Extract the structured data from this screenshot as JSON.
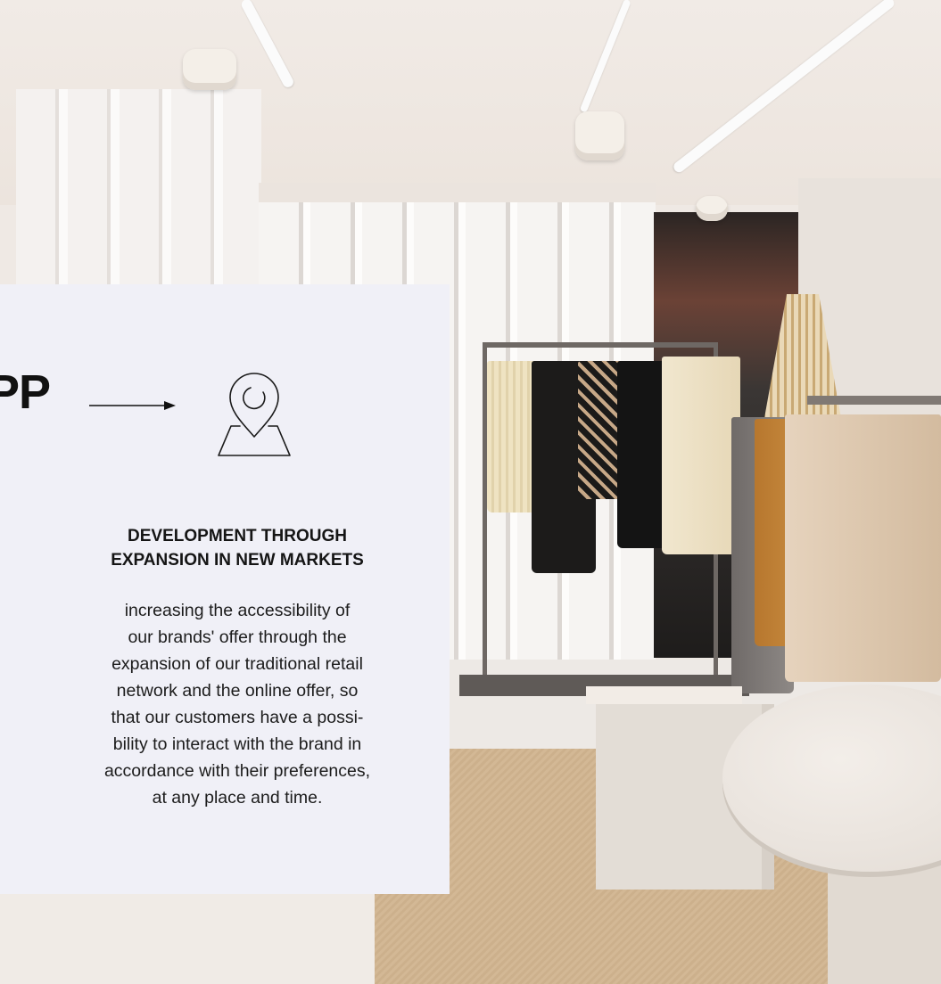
{
  "scene": {
    "description_icon": "store-interior-photo"
  },
  "card": {
    "brand_fragment": "PP",
    "arrow_icon": "right-arrow-icon",
    "location_icon": "map-pin-icon",
    "title_line1": "DEVELOPMENT THROUGH",
    "title_line2": "EXPANSION IN NEW MARKETS",
    "body_lines": [
      "increasing the accessibility of",
      "our brands' offer through the",
      "expansion of our traditional retail",
      "network and the online offer, so",
      "that our customers have a possi-",
      "bility to interact with the brand in",
      "accordance with their preferences,",
      "at any place and time."
    ]
  },
  "colors": {
    "card_background": "#f0f0f7",
    "text": "#151515"
  }
}
